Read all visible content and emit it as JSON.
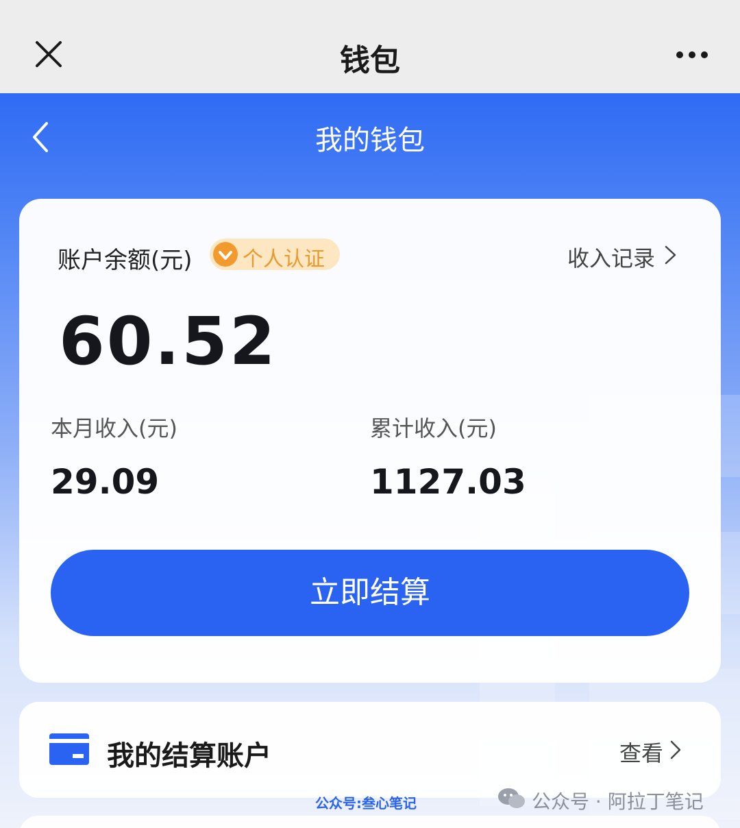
{
  "topbar": {
    "title": "钱包",
    "close_icon": "close-icon",
    "more_icon": "more-icon"
  },
  "subheader": {
    "title": "我的钱包",
    "back_icon": "chevron-left-icon"
  },
  "balance_card": {
    "label": "账户余额(元)",
    "badge_text": "个人认证",
    "badge_icon": "verified-check-icon",
    "income_link": "收入记录",
    "balance": "60.52",
    "month_label": "本月收入(元)",
    "month_value": "29.09",
    "total_label": "累计收入(元)",
    "total_value": "1127.03",
    "settle_button": "立即结算"
  },
  "account_card": {
    "title": "我的结算账户",
    "view_link": "查看",
    "icon": "card-icon"
  },
  "watermarks": {
    "left": "公众号:叁心笔记",
    "right": "公众号 · 阿拉丁笔记"
  },
  "colors": {
    "primary": "#2a63f1",
    "badge_bg": "#fde7c2",
    "badge_text": "#e89a2e",
    "topbar_bg": "#ededed"
  }
}
